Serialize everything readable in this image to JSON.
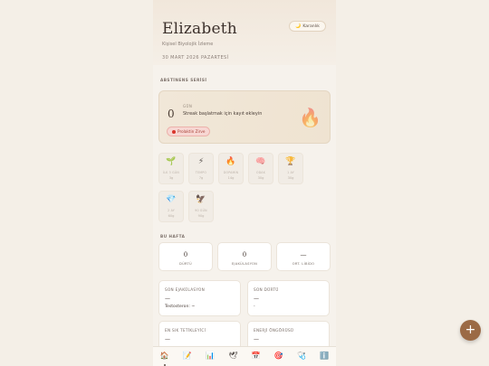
{
  "header": {
    "title": "Elizabeth",
    "subtitle": "Kişisel Biyolojik İzleme",
    "date": "30 MART 2026 PAZARTESİ",
    "theme_button": "Karanlık"
  },
  "streak": {
    "section_label": "ABSTİNENS SERİSİ",
    "count": "0",
    "unit": "GÜN",
    "message": "Streak başlatmak için kayıt ekleyin",
    "peak_badge": "Prolaktin Zirve"
  },
  "badges": [
    {
      "icon": "seedling-icon",
      "glyph": "🌱",
      "name": "İLK 3 GÜN",
      "days": "3g"
    },
    {
      "icon": "lightning-icon",
      "glyph": "⚡",
      "name": "TEMPO",
      "days": "7g"
    },
    {
      "icon": "flame-icon",
      "glyph": "🔥",
      "name": "DOPAMİN",
      "days": "14g"
    },
    {
      "icon": "brain-icon",
      "glyph": "🧠",
      "name": "ODAK",
      "days": "30g"
    },
    {
      "icon": "trophy-icon",
      "glyph": "🏆",
      "name": "1 AY",
      "days": "30g"
    },
    {
      "icon": "diamond-icon",
      "glyph": "💎",
      "name": "2 AY",
      "days": "60g"
    },
    {
      "icon": "eagle-icon",
      "glyph": "🦅",
      "name": "90 GÜN",
      "days": "90g"
    }
  ],
  "week": {
    "section_label": "BU HAFTA",
    "cards": [
      {
        "value": "0",
        "label": "DÜRTÜ"
      },
      {
        "value": "0",
        "label": "EJAKÜLASYON"
      },
      {
        "value": "—",
        "label": "ORT. LİBİDO"
      }
    ]
  },
  "info_cards": [
    {
      "label": "SON EJAKÜLASYON",
      "value": "—",
      "sub": "Testosteron: ~"
    },
    {
      "label": "SON DÜRTÜ",
      "value": "—",
      "sub": "-"
    },
    {
      "label": "EN SIK TETİKLEYİCİ",
      "value": "—",
      "sub": ""
    },
    {
      "label": "ENERJİ ÖNGÖRÜSÜ",
      "value": "—",
      "sub": ""
    }
  ],
  "nav": [
    {
      "name": "home-icon",
      "glyph": "🏠"
    },
    {
      "name": "journal-icon",
      "glyph": "📝"
    },
    {
      "name": "chart-icon",
      "glyph": "📊"
    },
    {
      "name": "bird-icon",
      "glyph": "🕊"
    },
    {
      "name": "calendar-icon",
      "glyph": "📅"
    },
    {
      "name": "target-icon",
      "glyph": "🎯"
    },
    {
      "name": "stethoscope-icon",
      "glyph": "🩺"
    },
    {
      "name": "info-icon",
      "glyph": "ℹ️"
    }
  ],
  "fab": {
    "label": "+"
  },
  "colors": {
    "accent": "#9b6a45",
    "peak": "#d9362b",
    "background": "#f6f2ec"
  }
}
